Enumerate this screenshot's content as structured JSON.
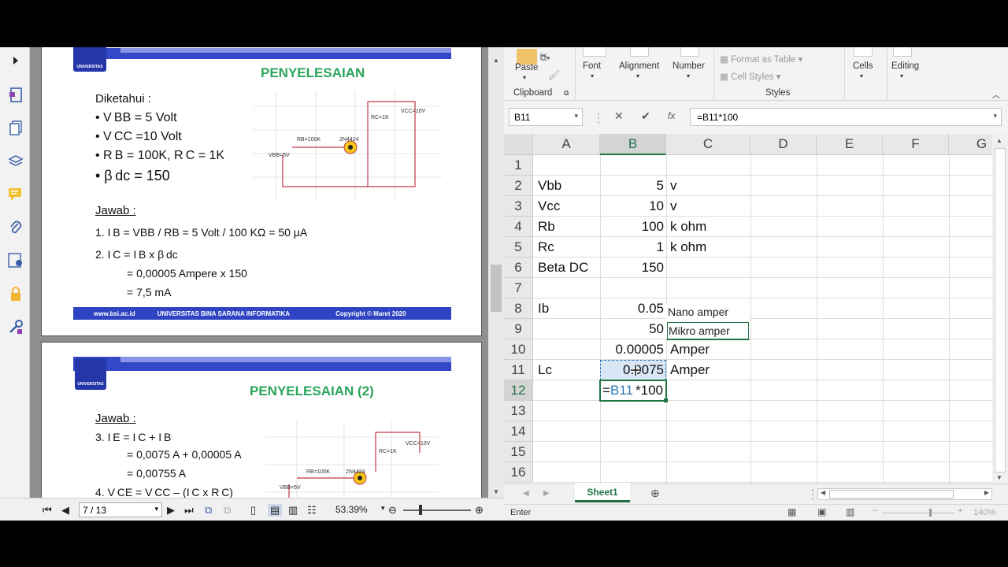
{
  "pdf": {
    "slide1": {
      "title": "PENYELESAIAN",
      "known_label": "Diketahui :",
      "known": [
        "• V BB = 5 Volt",
        "• V CC =10 Volt",
        "• R B = 100K, R C = 1K",
        "• β dc = 150"
      ],
      "answer_label": "Jawab :",
      "steps": [
        "1.  I B  = VBB / RB = 5 Volt / 100 KΩ = 50 μA",
        "2.  I C = I B x β dc",
        "= 0,00005 Ampere x 150",
        "= 7,5 mA"
      ],
      "circuit_labels": [
        "RC=1K",
        "VCC=10V",
        "RB=100K",
        "2N4424",
        "VBB=5V"
      ],
      "footer_url": "www.bsi.ac.id",
      "footer_univ": "UNIVERSITAS BINA SARANA INFORMATIKA",
      "footer_copy": "Copyright © Maret 2020",
      "logo_text": "UNIVERSITAS"
    },
    "slide2": {
      "title": "PENYELESAIAN (2)",
      "answer_label": "Jawab :",
      "steps": [
        "3. I E  = I C + I B",
        "= 0,0075 A + 0,00005  A",
        "= 0,00755 A",
        "4. V CE = V CC – (I C x R C)"
      ],
      "circuit_labels": [
        "RC=1K",
        "VCC=10V",
        "RB=100K",
        "2N4424",
        "VBB=5V"
      ],
      "logo_text": "UNIVERSITAS"
    },
    "page_input": "7 / 13",
    "zoom": "53.39%"
  },
  "excel": {
    "ribbon": {
      "paste": "Paste",
      "clipboard": "Clipboard",
      "font": "Font",
      "alignment": "Alignment",
      "number": "Number",
      "format_as_table": "Format as Table",
      "cell_styles": "Cell Styles",
      "styles": "Styles",
      "cells": "Cells",
      "editing": "Editing"
    },
    "name_box": "B11",
    "formula": "=B11*100",
    "fx": "fx",
    "columns": [
      "A",
      "B",
      "C",
      "D",
      "E",
      "F",
      "G"
    ],
    "rows": [
      "1",
      "2",
      "3",
      "4",
      "5",
      "6",
      "7",
      "8",
      "9",
      "10",
      "11",
      "12",
      "13",
      "14",
      "15",
      "16"
    ],
    "cells": {
      "A2": "Vbb",
      "B2": "5",
      "C2": "v",
      "A3": "Vcc",
      "B3": "10",
      "C3": "v",
      "A4": "Rb",
      "B4": "100",
      "C4": "k ohm",
      "A5": "Rc",
      "B5": "1",
      "C5": "k ohm",
      "A6": "Beta DC",
      "B6": "150",
      "A8": "Ib",
      "B8": "0.05",
      "B9": "50",
      "B10": "0.00005",
      "C10": "Amper",
      "A11": "Lc",
      "B11": "0.0075",
      "C11": "Amper",
      "B12_prefix": "=",
      "B12_ref": "B11",
      "B12_rest": "*100"
    },
    "autocomplete": [
      "Nano amper",
      "Mikro amper"
    ],
    "sheet_tab": "Sheet1",
    "status": "Enter",
    "zoom": "140%",
    "colors": {
      "excel_green": "#217346",
      "ref_blue": "#2f75b5"
    }
  }
}
